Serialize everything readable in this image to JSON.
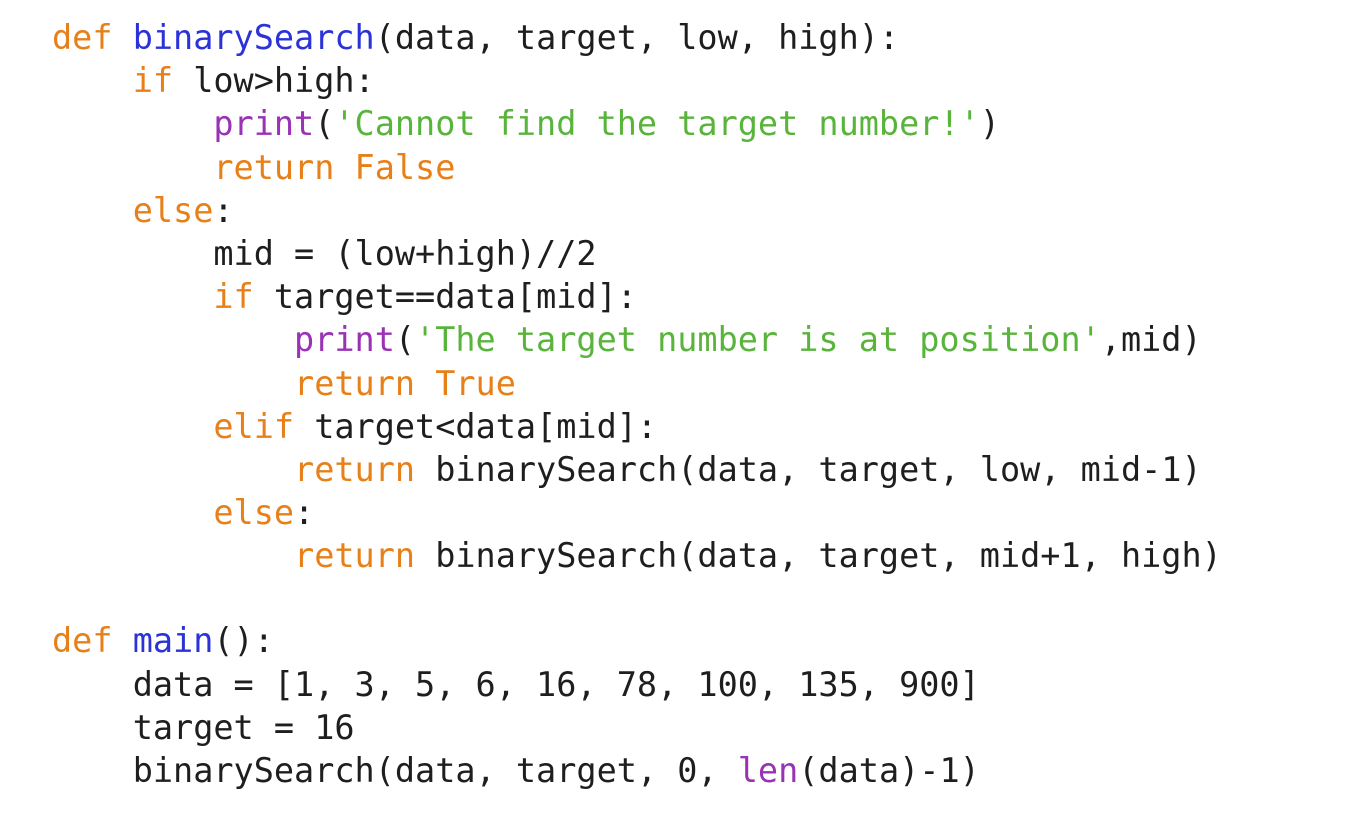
{
  "editor": {
    "colors": {
      "keyword": "#e8801a",
      "function_name": "#2a32d8",
      "builtin": "#9932b5",
      "string": "#59b43c",
      "default": "#1e1e1e",
      "background": "#ffffff"
    },
    "lines": [
      {
        "indent": "",
        "tokens": [
          {
            "t": "def",
            "c": "kw"
          },
          {
            "t": " "
          },
          {
            "t": "binarySearch",
            "c": "fn"
          },
          {
            "t": "(data, target, low, high):"
          }
        ]
      },
      {
        "indent": "    ",
        "tokens": [
          {
            "t": "if",
            "c": "kw"
          },
          {
            "t": " low>high:"
          }
        ]
      },
      {
        "indent": "        ",
        "tokens": [
          {
            "t": "print",
            "c": "bi"
          },
          {
            "t": "("
          },
          {
            "t": "'Cannot find the target number!'",
            "c": "str"
          },
          {
            "t": ")"
          }
        ]
      },
      {
        "indent": "        ",
        "tokens": [
          {
            "t": "return",
            "c": "kw"
          },
          {
            "t": " "
          },
          {
            "t": "False",
            "c": "kw"
          }
        ]
      },
      {
        "indent": "    ",
        "tokens": [
          {
            "t": "else",
            "c": "kw"
          },
          {
            "t": ":"
          }
        ]
      },
      {
        "indent": "        ",
        "tokens": [
          {
            "t": "mid = (low+high)//2"
          }
        ]
      },
      {
        "indent": "        ",
        "tokens": [
          {
            "t": "if",
            "c": "kw"
          },
          {
            "t": " target==data[mid]:"
          }
        ]
      },
      {
        "indent": "            ",
        "tokens": [
          {
            "t": "print",
            "c": "bi"
          },
          {
            "t": "("
          },
          {
            "t": "'The target number is at position'",
            "c": "str"
          },
          {
            "t": ",mid)"
          }
        ]
      },
      {
        "indent": "            ",
        "tokens": [
          {
            "t": "return",
            "c": "kw"
          },
          {
            "t": " "
          },
          {
            "t": "True",
            "c": "kw"
          }
        ]
      },
      {
        "indent": "        ",
        "tokens": [
          {
            "t": "elif",
            "c": "kw"
          },
          {
            "t": " target<data[mid]:"
          }
        ]
      },
      {
        "indent": "            ",
        "tokens": [
          {
            "t": "return",
            "c": "kw"
          },
          {
            "t": " binarySearch(data, target, low, mid-1)"
          }
        ]
      },
      {
        "indent": "        ",
        "tokens": [
          {
            "t": "else",
            "c": "kw"
          },
          {
            "t": ":"
          }
        ]
      },
      {
        "indent": "            ",
        "tokens": [
          {
            "t": "return",
            "c": "kw"
          },
          {
            "t": " binarySearch(data, target, mid+1, high)"
          }
        ]
      },
      {
        "blank": true
      },
      {
        "indent": "",
        "tokens": [
          {
            "t": "def",
            "c": "kw"
          },
          {
            "t": " "
          },
          {
            "t": "main",
            "c": "fn"
          },
          {
            "t": "():"
          }
        ]
      },
      {
        "indent": "    ",
        "tokens": [
          {
            "t": "data = [1, 3, 5, 6, 16, 78, 100, 135, 900]"
          }
        ]
      },
      {
        "indent": "    ",
        "tokens": [
          {
            "t": "target = 16"
          }
        ]
      },
      {
        "indent": "    ",
        "tokens": [
          {
            "t": "binarySearch(data, target, 0, "
          },
          {
            "t": "len",
            "c": "bi"
          },
          {
            "t": "(data)-1)"
          }
        ]
      }
    ]
  }
}
